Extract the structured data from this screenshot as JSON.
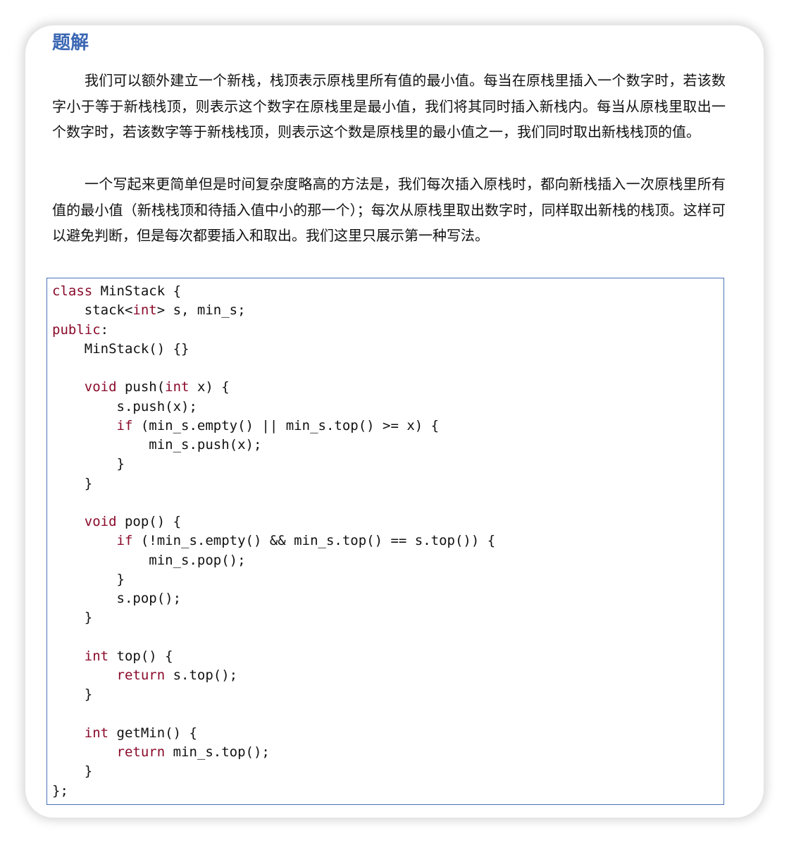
{
  "heading": "题解",
  "paragraphs": [
    "我们可以额外建立一个新栈，栈顶表示原栈里所有值的最小值。每当在原栈里插入一个数字时，若该数字小于等于新栈栈顶，则表示这个数字在原栈里是最小值，我们将其同时插入新栈内。每当从原栈里取出一个数字时，若该数字等于新栈栈顶，则表示这个数是原栈里的最小值之一，我们同时取出新栈栈顶的值。",
    "一个写起来更简单但是时间复杂度略高的方法是，我们每次插入原栈时，都向新栈插入一次原栈里所有值的最小值（新栈栈顶和待插入值中小的那一个）；每次从原栈里取出数字时，同样取出新栈的栈顶。这样可以避免判断，但是每次都要插入和取出。我们这里只展示第一种写法。"
  ],
  "code": {
    "keyword_color": "#8a0a2a",
    "lines": [
      [
        {
          "t": "class",
          "k": true
        },
        {
          "t": " MinStack {"
        }
      ],
      [
        {
          "t": "    stack<"
        },
        {
          "t": "int",
          "k": true
        },
        {
          "t": "> s, min_s;"
        }
      ],
      [
        {
          "t": "public",
          "k": true
        },
        {
          "t": ":"
        }
      ],
      [
        {
          "t": "    MinStack() {}"
        }
      ],
      [
        {
          "t": ""
        }
      ],
      [
        {
          "t": "    "
        },
        {
          "t": "void",
          "k": true
        },
        {
          "t": " push("
        },
        {
          "t": "int",
          "k": true
        },
        {
          "t": " x) {"
        }
      ],
      [
        {
          "t": "        s.push(x);"
        }
      ],
      [
        {
          "t": "        "
        },
        {
          "t": "if",
          "k": true
        },
        {
          "t": " (min_s.empty() || min_s.top() >= x) {"
        }
      ],
      [
        {
          "t": "            min_s.push(x);"
        }
      ],
      [
        {
          "t": "        }"
        }
      ],
      [
        {
          "t": "    }"
        }
      ],
      [
        {
          "t": ""
        }
      ],
      [
        {
          "t": "    "
        },
        {
          "t": "void",
          "k": true
        },
        {
          "t": " pop() {"
        }
      ],
      [
        {
          "t": "        "
        },
        {
          "t": "if",
          "k": true
        },
        {
          "t": " (!min_s.empty() && min_s.top() == s.top()) {"
        }
      ],
      [
        {
          "t": "            min_s.pop();"
        }
      ],
      [
        {
          "t": "        }"
        }
      ],
      [
        {
          "t": "        s.pop();"
        }
      ],
      [
        {
          "t": "    }"
        }
      ],
      [
        {
          "t": ""
        }
      ],
      [
        {
          "t": "    "
        },
        {
          "t": "int",
          "k": true
        },
        {
          "t": " top() {"
        }
      ],
      [
        {
          "t": "        "
        },
        {
          "t": "return",
          "k": true
        },
        {
          "t": " s.top();"
        }
      ],
      [
        {
          "t": "    }"
        }
      ],
      [
        {
          "t": ""
        }
      ],
      [
        {
          "t": "    "
        },
        {
          "t": "int",
          "k": true
        },
        {
          "t": " getMin() {"
        }
      ],
      [
        {
          "t": "        "
        },
        {
          "t": "return",
          "k": true
        },
        {
          "t": " min_s.top();"
        }
      ],
      [
        {
          "t": "    }"
        }
      ],
      [
        {
          "t": "};"
        }
      ]
    ]
  }
}
